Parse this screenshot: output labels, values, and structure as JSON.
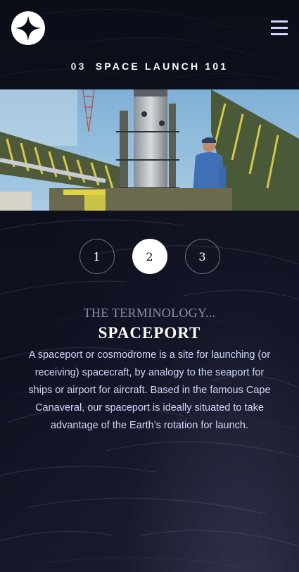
{
  "header": {
    "logo_icon": "four-point-star-icon",
    "menu_icon": "hamburger-menu-icon"
  },
  "page": {
    "number": "03",
    "title": "SPACE LAUNCH 101"
  },
  "hero": {
    "image": "launch-pad-photo"
  },
  "pager": {
    "items": [
      {
        "label": "1",
        "active": false
      },
      {
        "label": "2",
        "active": true
      },
      {
        "label": "3",
        "active": false
      }
    ]
  },
  "content": {
    "eyebrow": "THE TERMINOLOGY...",
    "title": "SPACEPORT",
    "description": "A spaceport or cosmodrome is a site for launching (or receiving) spacecraft, by analogy to the seaport for ships or airport for aircraft. Based in the famous Cape Canaveral, our spaceport is ideally situated to take advantage of the Earth’s rotation for launch."
  },
  "colors": {
    "background": "#0b0d17",
    "text_light": "#d0d6f9",
    "accent_white": "#ffffff",
    "eyebrow_grey": "#8d90a0"
  }
}
